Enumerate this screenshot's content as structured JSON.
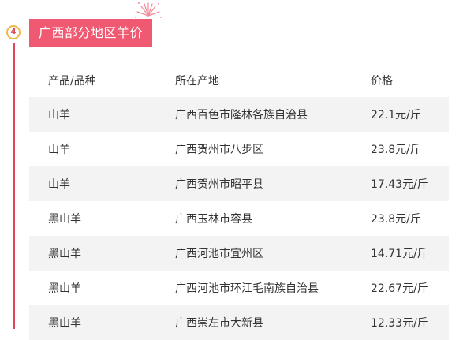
{
  "section": {
    "number": "4",
    "title": "广西部分地区羊价",
    "accent_color": "#ef5a72",
    "line_color": "#e0475d",
    "badge_ring_color": "#f0b84a",
    "decoration_icon": "sparkle-burst-icon"
  },
  "table": {
    "headers": [
      "产品/品种",
      "所在产地",
      "价格"
    ],
    "rows": [
      [
        "山羊",
        "广西百色市隆林各族自治县",
        "22.1元/斤"
      ],
      [
        "山羊",
        "广西贺州市八步区",
        "23.8元/斤"
      ],
      [
        "山羊",
        "广西贺州市昭平县",
        "17.43元/斤"
      ],
      [
        "黑山羊",
        "广西玉林市容县",
        "23.8元/斤"
      ],
      [
        "黑山羊",
        "广西河池市宜州区",
        "14.71元/斤"
      ],
      [
        "黑山羊",
        "广西河池市环江毛南族自治县",
        "22.67元/斤"
      ],
      [
        "黑山羊",
        "广西崇左市大新县",
        "12.33元/斤"
      ]
    ],
    "row_alt_color": "#f3f3f3"
  }
}
